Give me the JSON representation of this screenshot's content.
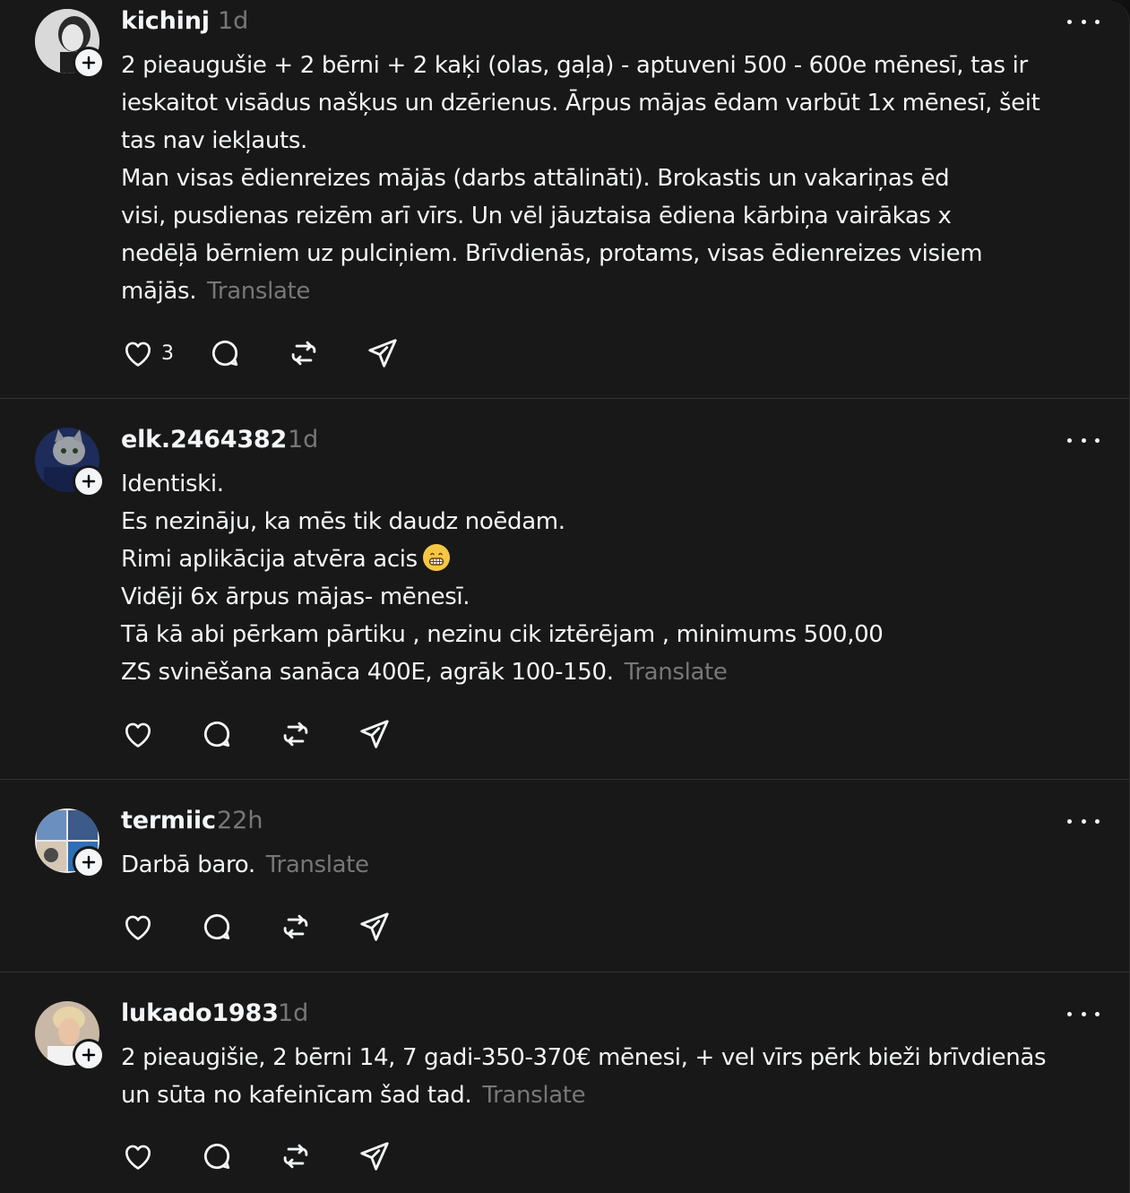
{
  "posts": [
    {
      "username": "kichinj",
      "time": "1d",
      "lines": [
        "2 pieaugušie + 2 bērni + 2 kaķi (olas, gaļa) - aptuveni 500 - 600e mēnesī, tas ir",
        "ieskaitot visādus našķus un dzērienus. Ārpus mājas ēdam varbūt 1x mēnesī, šeit",
        "tas nav iekļauts.",
        "Man visas ēdienreizes mājās (darbs attālināti). Brokastis un vakariņas ēd",
        "visi, pusdienas reizēm arī vīrs. Un vēl jāuztaisa ēdiena kārbiņa vairākas x",
        "nedēļā bērniem uz pulciņiem. Brīvdienās, protams, visas ēdienreizes visiem",
        "mājās."
      ],
      "translate": "Translate",
      "likes": "3"
    },
    {
      "username": "elk.2464382",
      "time": "1d",
      "lines": [
        "Identiski.",
        "Es nezināju, ka mēs tik daudz noēdam.",
        "Rimi aplikācija atvēra acis",
        "Vidēji 6x ārpus mājas- mēnesī.",
        "Tā kā abi pērkam pārtiku , nezinu cik iztērējam , minimums 500,00",
        "ZS svinēšana sanāca 400E, agrāk 100-150."
      ],
      "translate": "Translate",
      "emoji": "grinning-face-emoji"
    },
    {
      "username": "termiic",
      "time": "22h",
      "lines": [
        "Darbā baro."
      ],
      "translate": "Translate"
    },
    {
      "username": "lukado1983",
      "time": "1d",
      "lines": [
        "2 pieaugišie, 2 bērni 14, 7 gadi-350-370€ mēnesi, + vel vīrs pērk bieži brīvdienās",
        "un sūta no kafeinīcam šad tad."
      ],
      "translate": "Translate"
    }
  ],
  "colors": {
    "background": "#181818",
    "text": "#f3f5f7",
    "muted": "#777777",
    "divider": "#323232"
  },
  "icons": [
    "heart-icon",
    "comment-icon",
    "repost-icon",
    "share-icon",
    "more-icon",
    "follow-plus-icon"
  ]
}
